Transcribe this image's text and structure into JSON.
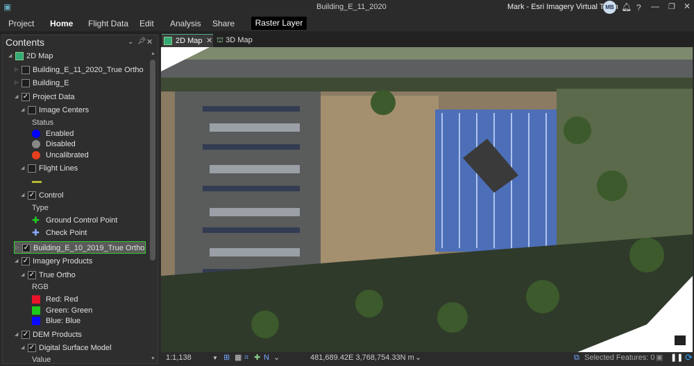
{
  "window": {
    "title": "Building_E_11_2020",
    "user": "Mark - Esri Imagery Virtual Team",
    "avatar": "MB",
    "help": "?"
  },
  "ribbon": {
    "tabs": [
      "Project",
      "Home",
      "Flight Data",
      "Edit",
      "Analysis",
      "Share"
    ],
    "contextual": "Raster Layer"
  },
  "contents": {
    "title": "Contents",
    "rows": [
      {
        "level": 0,
        "expander": "open",
        "check": null,
        "icon": "map",
        "label": "2D Map"
      },
      {
        "level": 1,
        "expander": "closed",
        "check": false,
        "label": "Building_E_11_2020_True Ortho"
      },
      {
        "level": 1,
        "expander": "closed",
        "check": false,
        "label": "Building_E"
      },
      {
        "level": 1,
        "expander": "open",
        "check": true,
        "label": "Project Data"
      },
      {
        "level": 2,
        "expander": "open",
        "check": false,
        "label": "Image Centers"
      },
      {
        "level": 3,
        "heading": true,
        "label": "Status"
      },
      {
        "level": 3,
        "swatch": "circle",
        "color": "#0000ff",
        "label": "Enabled"
      },
      {
        "level": 3,
        "swatch": "circle",
        "color": "#888888",
        "label": "Disabled"
      },
      {
        "level": 3,
        "swatch": "circle",
        "color": "#e8401c",
        "label": "Uncalibrated"
      },
      {
        "level": 2,
        "expander": "open",
        "check": false,
        "label": "Flight Lines"
      },
      {
        "level": 3,
        "swatch": "line",
        "color": "#b8b830",
        "label": ""
      },
      {
        "level": 2,
        "expander": "open",
        "check": true,
        "label": "Control"
      },
      {
        "level": 3,
        "heading": true,
        "label": "Type"
      },
      {
        "level": 3,
        "swatch": "plus",
        "color": "#22cc22",
        "label": "Ground Control Point"
      },
      {
        "level": 3,
        "swatch": "plus",
        "color": "#88aaff",
        "label": "Check Point"
      },
      {
        "level": 1,
        "expander": "closed",
        "check": true,
        "selected": true,
        "label": "Building_E_10_2019_True Ortho"
      },
      {
        "level": 1,
        "expander": "open",
        "check": true,
        "label": "Imagery Products"
      },
      {
        "level": 2,
        "expander": "open",
        "check": true,
        "label": "True Ortho"
      },
      {
        "level": 3,
        "heading": true,
        "label": "RGB"
      },
      {
        "level": 3,
        "swatch": "rect",
        "color": "#e8132a",
        "label": "Red:   Red"
      },
      {
        "level": 3,
        "swatch": "rect",
        "color": "#1cc81c",
        "label": "Green: Green"
      },
      {
        "level": 3,
        "swatch": "rect",
        "color": "#0a0aff",
        "label": "Blue:  Blue"
      },
      {
        "level": 1,
        "expander": "open",
        "check": true,
        "label": "DEM Products"
      },
      {
        "level": 2,
        "expander": "open",
        "check": true,
        "label": "Digital Surface Model"
      },
      {
        "level": 3,
        "heading": true,
        "label": "Value"
      }
    ]
  },
  "map_tabs": [
    {
      "label": "2D Map",
      "active": true
    },
    {
      "label": "3D Map",
      "active": false
    }
  ],
  "status": {
    "scale": "1:1,138",
    "coords": "481,689.42E 3,768,754.33N m",
    "selected": "Selected Features: 0"
  }
}
